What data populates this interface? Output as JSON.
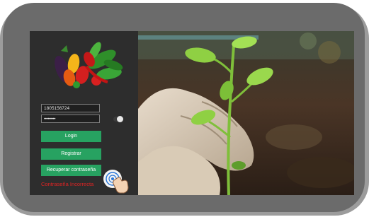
{
  "login": {
    "user_value": "1805156724",
    "password_value": "•••••••••",
    "login_label": "Login",
    "register_label": "Registrar",
    "recover_label": "Recuperar contraseña",
    "error_text": "Contraseña Incorrecta"
  },
  "icons": {
    "logo": "vegetables-logo",
    "toggle": "show-password-toggle",
    "tap": "tap-hand-icon"
  },
  "colors": {
    "button": "#27a261",
    "error": "#e02424",
    "panel": "#2d2d2d",
    "frame": "#6b6b6b"
  }
}
